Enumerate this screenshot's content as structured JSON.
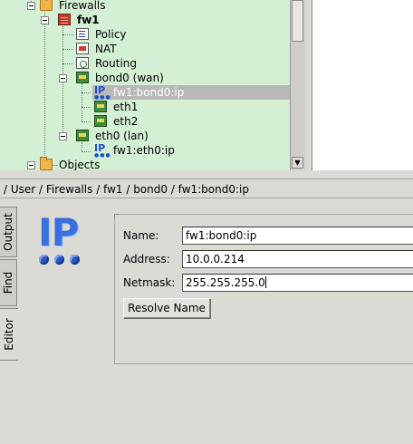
{
  "tree": {
    "items": [
      {
        "label": "Firewalls",
        "icon": "folder-icon",
        "expanded": true,
        "bold": false
      },
      {
        "label": "fw1",
        "icon": "firewall-icon",
        "expanded": true,
        "bold": true
      },
      {
        "label": "Policy",
        "icon": "policy-icon",
        "bold": false
      },
      {
        "label": "NAT",
        "icon": "nat-icon",
        "bold": false
      },
      {
        "label": "Routing",
        "icon": "routing-icon",
        "bold": false
      },
      {
        "label": "bond0 (wan)",
        "icon": "interface-icon",
        "expanded": true,
        "bold": false
      },
      {
        "label": "fw1:bond0:ip",
        "icon": "ip-address-icon",
        "selected": true,
        "bold": false
      },
      {
        "label": "eth1",
        "icon": "interface-icon",
        "bold": false
      },
      {
        "label": "eth2",
        "icon": "interface-icon",
        "bold": false
      },
      {
        "label": "eth0 (lan)",
        "icon": "interface-icon",
        "expanded": true,
        "bold": false
      },
      {
        "label": "fw1:eth0:ip",
        "icon": "ip-address-icon",
        "bold": false
      },
      {
        "label": "Objects",
        "icon": "folder-icon",
        "bold": false
      }
    ]
  },
  "breadcrumb": "/ User / Firewalls / fw1 / bond0 / fw1:bond0:ip",
  "tabs": [
    {
      "label": "Output",
      "active": false
    },
    {
      "label": "Find",
      "active": false
    },
    {
      "label": "Editor",
      "active": true
    }
  ],
  "editor": {
    "icon": "ip-address-large-icon",
    "icon_text": "IP",
    "fields": {
      "name": {
        "label": "Name:",
        "value": "fw1:bond0:ip"
      },
      "address": {
        "label": "Address:",
        "value": "10.0.0.214"
      },
      "netmask": {
        "label": "Netmask:",
        "value": "255.255.255.0"
      }
    },
    "resolve_button": "Resolve Name"
  },
  "colors": {
    "tree_background": "#d4f0d4",
    "selection": "#b8b8b8",
    "ip_icon_blue": "#3a6fe0"
  }
}
